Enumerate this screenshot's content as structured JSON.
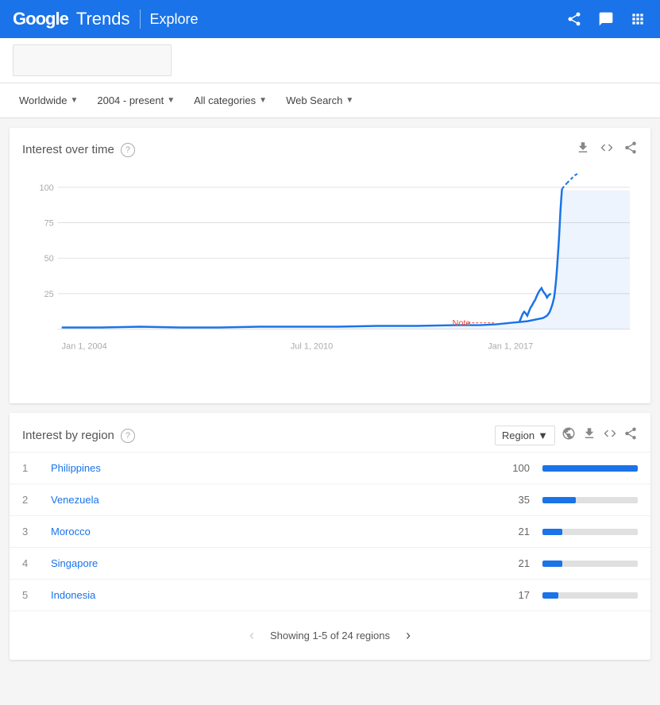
{
  "header": {
    "logo": "Google Trends",
    "explore_label": "Explore",
    "icons": [
      "share-icon",
      "feedback-icon",
      "apps-icon"
    ]
  },
  "filters": {
    "location": {
      "label": "Worldwide",
      "value": "Worldwide"
    },
    "time": {
      "label": "2004 - present",
      "value": "2004 - present"
    },
    "category": {
      "label": "All categories",
      "value": "All categories"
    },
    "search_type": {
      "label": "Web Search",
      "value": "Web Search"
    }
  },
  "interest_over_time": {
    "title": "Interest over time",
    "y_labels": [
      "100",
      "75",
      "50",
      "25"
    ],
    "x_labels": [
      "Jan 1, 2004",
      "Jul 1, 2010",
      "Jan 1, 2017"
    ],
    "note_label": "Note",
    "actions": [
      "download-icon",
      "embed-icon",
      "share-icon"
    ]
  },
  "interest_by_region": {
    "title": "Interest by region",
    "region_dropdown": "Region",
    "actions": [
      "globe-icon",
      "download-icon",
      "embed-icon",
      "share-icon"
    ],
    "regions": [
      {
        "rank": 1,
        "name": "Philippines",
        "value": 100,
        "bar_pct": 100
      },
      {
        "rank": 2,
        "name": "Venezuela",
        "value": 35,
        "bar_pct": 35
      },
      {
        "rank": 3,
        "name": "Morocco",
        "value": 21,
        "bar_pct": 21
      },
      {
        "rank": 4,
        "name": "Singapore",
        "value": 21,
        "bar_pct": 21
      },
      {
        "rank": 5,
        "name": "Indonesia",
        "value": 17,
        "bar_pct": 17
      }
    ],
    "pagination": {
      "label": "Showing 1-5 of 24 regions"
    }
  }
}
